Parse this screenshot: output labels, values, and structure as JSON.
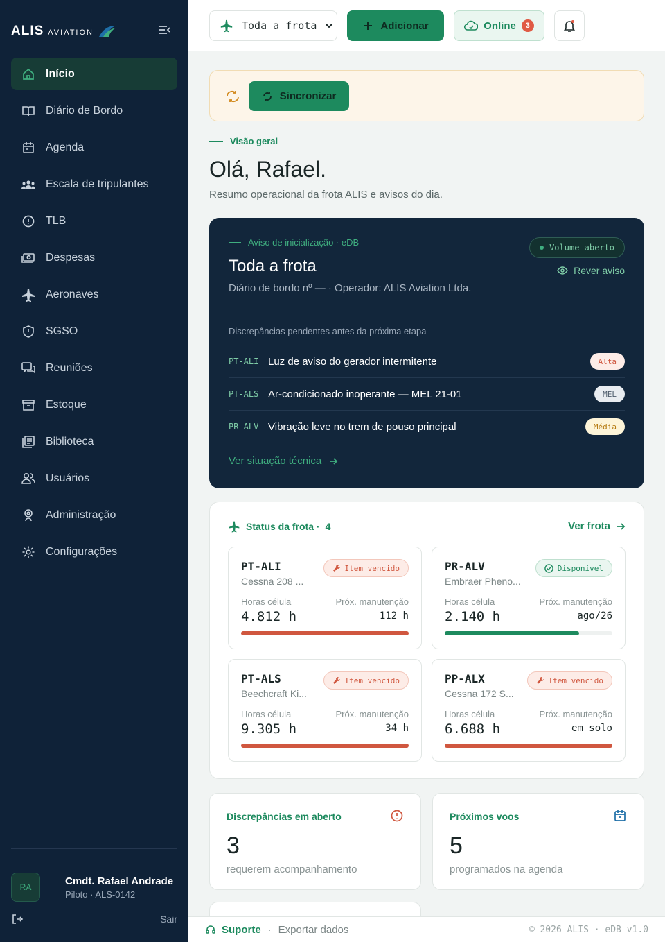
{
  "brand": {
    "name": "ALIS",
    "sub": "AVIATION"
  },
  "sidebar": {
    "items": [
      {
        "label": "Início",
        "icon": "home-icon"
      },
      {
        "label": "Diário de Bordo",
        "icon": "book-icon"
      },
      {
        "label": "Agenda",
        "icon": "calendar-icon"
      },
      {
        "label": "Escala de tripulantes",
        "icon": "crew-icon"
      },
      {
        "label": "TLB",
        "icon": "alert-circle-icon"
      },
      {
        "label": "Despesas",
        "icon": "cash-icon"
      },
      {
        "label": "Aeronaves",
        "icon": "plane-icon"
      },
      {
        "label": "SGSO",
        "icon": "shield-icon"
      },
      {
        "label": "Reuniões",
        "icon": "chat-icon"
      },
      {
        "label": "Estoque",
        "icon": "archive-icon"
      },
      {
        "label": "Biblioteca",
        "icon": "library-icon"
      },
      {
        "label": "Usuários",
        "icon": "users-icon"
      },
      {
        "label": "Administração",
        "icon": "admin-icon"
      },
      {
        "label": "Configurações",
        "icon": "gear-icon"
      }
    ],
    "user": {
      "initials": "RA",
      "name": "Cmdt. Rafael Andrade",
      "role": "Piloto · ALS-0142"
    },
    "logout_label": "Sair"
  },
  "topbar": {
    "fleet_select": "Toda a frota",
    "add_label": "Adicionar",
    "online_label": "Online",
    "online_count": "3"
  },
  "sync": {
    "button_label": "Sincronizar"
  },
  "overview": {
    "eyebrow": "Visão geral",
    "greeting": "Olá, Rafael.",
    "subtitle": "Resumo operacional da frota ALIS e avisos do dia."
  },
  "notice": {
    "eyebrow": "Aviso de inicialização · eDB",
    "title": "Toda a frota",
    "subtitle": "Diário de bordo nº — · Operador: ALIS Aviation Ltda.",
    "volume_label": "Volume aberto",
    "review_label": "Rever aviso",
    "section_label": "Discrepâncias pendentes antes da próxima etapa",
    "discrepancies": [
      {
        "reg": "PT-ALI",
        "text": "Luz de aviso do gerador intermitente",
        "tag": "Alta"
      },
      {
        "reg": "PT-ALS",
        "text": "Ar-condicionado inoperante — MEL 21-01",
        "tag": "MEL"
      },
      {
        "reg": "PR-ALV",
        "text": "Vibração leve no trem de pouso principal",
        "tag": "Média"
      }
    ],
    "link_label": "Ver situação técnica"
  },
  "fleet": {
    "title": "Status da frota ·",
    "count": "4",
    "link_label": "Ver frota",
    "hours_label": "Horas célula",
    "maint_label": "Próx. manutenção",
    "aircraft": [
      {
        "reg": "PT-ALI",
        "model": "Cessna 208 ...",
        "status": "Item vencido",
        "hours": "4.812 h",
        "maint": "112 h",
        "progress": 1.0,
        "color": "#d0573f"
      },
      {
        "reg": "PR-ALV",
        "model": "Embraer Pheno...",
        "status": "Disponível",
        "hours": "2.140 h",
        "maint": "ago/26",
        "progress": 0.8,
        "color": "#1d8a5e"
      },
      {
        "reg": "PT-ALS",
        "model": "Beechcraft Ki...",
        "status": "Item vencido",
        "hours": "9.305 h",
        "maint": "34 h",
        "progress": 1.0,
        "color": "#d0573f"
      },
      {
        "reg": "PP-ALX",
        "model": "Cessna 172 S...",
        "status": "Item vencido",
        "hours": "6.688 h",
        "maint": "em solo",
        "progress": 1.0,
        "color": "#d0573f"
      }
    ]
  },
  "stats": [
    {
      "title": "Discrepâncias em aberto",
      "value": "3",
      "sub": "requerem acompanhamento"
    },
    {
      "title": "Próximos voos",
      "value": "5",
      "sub": "programados na agenda"
    }
  ],
  "footer": {
    "support_label": "Suporte",
    "separator": "·",
    "export_label": "Exportar dados",
    "copyright": "© 2026 ALIS · eDB v1.0"
  }
}
